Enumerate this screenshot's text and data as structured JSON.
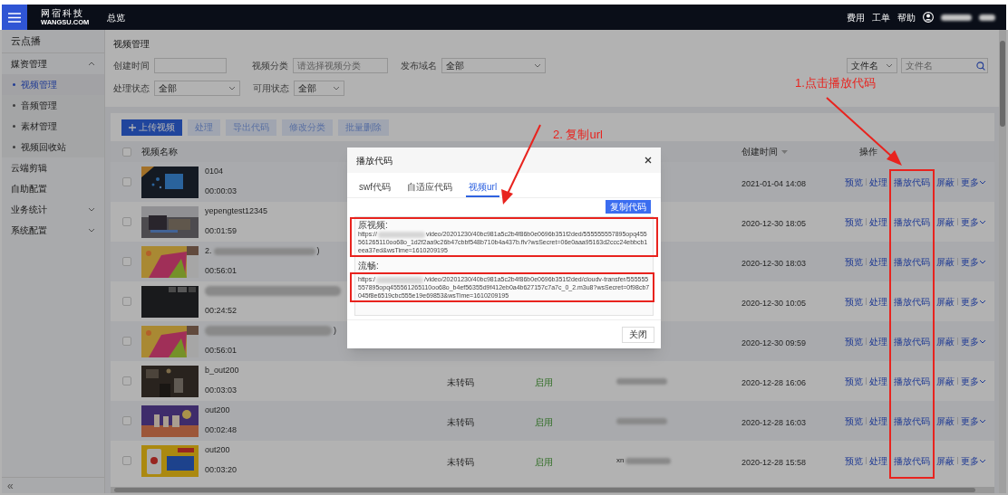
{
  "topbar": {
    "logo_cn": "网宿科技",
    "logo_en": "WANGSU.COM",
    "nav": "总览",
    "links": [
      "费用",
      "工单",
      "帮助"
    ]
  },
  "sidebar": {
    "title": "云点播",
    "items": [
      {
        "label": "媒资管理",
        "selected": false,
        "expanded": true,
        "children": [
          {
            "label": "视频管理",
            "selected": true
          },
          {
            "label": "音频管理",
            "selected": false
          },
          {
            "label": "素材管理",
            "selected": false
          },
          {
            "label": "视频回收站",
            "selected": false
          }
        ]
      },
      {
        "label": "云端剪辑",
        "selected": false
      },
      {
        "label": "自助配置",
        "selected": false
      },
      {
        "label": "业务统计",
        "selected": false,
        "expanded": false
      },
      {
        "label": "系统配置",
        "selected": false,
        "expanded": false
      }
    ],
    "collapse": "«"
  },
  "page_title": "视频管理",
  "filters": [
    [
      {
        "label": "创建时间",
        "kind": "input"
      },
      {
        "label": "视频分类",
        "kind": "input",
        "placeholder": "请选择视频分类"
      },
      {
        "label": "发布域名",
        "kind": "select",
        "value": "全部"
      }
    ],
    [
      {
        "label": "处理状态",
        "kind": "select",
        "value": "全部"
      },
      {
        "label": "可用状态",
        "kind": "select",
        "value": "全部"
      }
    ]
  ],
  "search": {
    "field": "文件名",
    "placeholder": "文件名"
  },
  "toolbar": [
    {
      "label": "上传视频",
      "kind": "primary",
      "disabled": false
    },
    {
      "label": "处理",
      "kind": "plain",
      "disabled": true
    },
    {
      "label": "导出代码",
      "kind": "plain",
      "disabled": true
    },
    {
      "label": "修改分类",
      "kind": "plain",
      "disabled": true
    },
    {
      "label": "批量删除",
      "kind": "plain",
      "disabled": true
    }
  ],
  "table": {
    "header_checked": false,
    "columns": [
      {
        "label": "视频名称"
      },
      {
        "label": "创建时间",
        "sortable": true
      },
      {
        "label": "操作"
      }
    ],
    "rows": [
      {
        "checked": false,
        "name": "0104",
        "duration": "00:00:03",
        "created": "2021-01-04 14:08",
        "actions": [
          "预览",
          "处理",
          "播放代码",
          "屏蔽",
          "更多"
        ]
      },
      {
        "checked": false,
        "name": "yepengtest12345",
        "duration": "00:01:59",
        "created": "2020-12-30 18:05",
        "actions": [
          "预览",
          "处理",
          "播放代码",
          "屏蔽",
          "更多"
        ]
      },
      {
        "checked": false,
        "name": "2.",
        "name_redacted": true,
        "name_tail": ")",
        "duration": "00:56:01",
        "created": "2020-12-30 18:03",
        "actions": [
          "预览",
          "处理",
          "播放代码",
          "屏蔽",
          "更多"
        ]
      },
      {
        "checked": false,
        "name_redacted": true,
        "duration": "00:24:52",
        "created": "2020-12-30 10:05",
        "actions": [
          "预览",
          "处理",
          "播放代码",
          "屏蔽",
          "更多"
        ]
      },
      {
        "checked": false,
        "name_redacted": true,
        "name_tail": ")",
        "duration": "00:56:01",
        "created": "2020-12-30 09:59",
        "actions": [
          "预览",
          "处理",
          "播放代码",
          "屏蔽",
          "更多"
        ]
      },
      {
        "checked": false,
        "name": "b_out200",
        "duration": "00:03:03",
        "transcode": "未转码",
        "availability": "启用",
        "domain_redacted": true,
        "created": "2020-12-28 16:06",
        "actions": [
          "预览",
          "处理",
          "播放代码",
          "屏蔽",
          "更多"
        ]
      },
      {
        "checked": false,
        "name": "out200",
        "duration": "00:02:48",
        "transcode": "未转码",
        "availability": "启用",
        "domain_redacted": true,
        "created": "2020-12-28 16:03",
        "actions": [
          "预览",
          "处理",
          "播放代码",
          "屏蔽",
          "更多"
        ]
      },
      {
        "checked": false,
        "name": "out200",
        "duration": "00:03:20",
        "transcode": "未转码",
        "availability": "启用",
        "domain_prefix": "xn",
        "domain_redacted": true,
        "created": "2020-12-28 15:58",
        "actions": [
          "预览",
          "处理",
          "播放代码",
          "屏蔽",
          "更多"
        ]
      }
    ]
  },
  "modal": {
    "title": "播放代码",
    "tabs": [
      {
        "label": "swf代码",
        "selected": false
      },
      {
        "label": "自适应代码",
        "selected": false
      },
      {
        "label": "视频url",
        "selected": true
      }
    ],
    "copy_button": "复制代码",
    "entries": [
      {
        "label": "原视频:",
        "url_head": "https://",
        "url_rest": "video/20201230/40bc981a5c2b4f86b0e0696b351f2ded/555555557895opq455561265110oo68o_1d2f2aa9c26b47cbbf548b710b4a437b.flv?wsSecret=06e0aaa95163d2ccc24ebbcb1eea37ed&wsTime=1610209195"
      },
      {
        "label": "流畅:",
        "url_head": "https:/",
        "url_rest": "/video/20201230/40bc981a5c2b4f86b0e0696b351f2ded/cloudv-transfer/555555557895opq455561265110oo68o_b4ef56355d9f412eb0a4b627157c7a7c_0_2.m3u8?wsSecret=0f98cb7045f8e6519cbc555e19e69853&wsTime=1610209195"
      }
    ],
    "close_button": "关闭"
  },
  "annotations": [
    {
      "text": "1.点击播放代码"
    },
    {
      "text": "2. 复制url"
    }
  ]
}
